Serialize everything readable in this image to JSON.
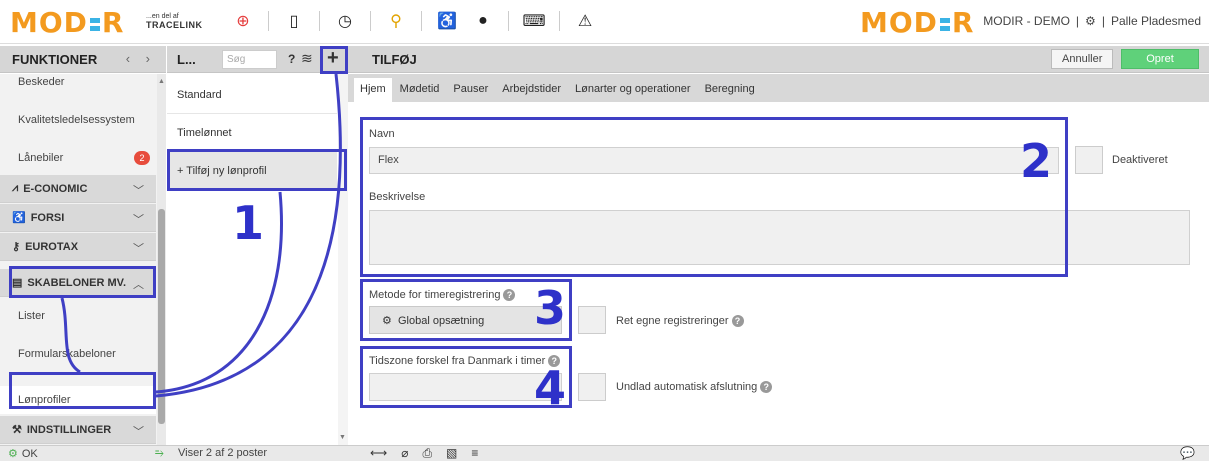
{
  "header": {
    "logo_text": "MODIR",
    "tagline_small": "...en del af",
    "tagline_brand": "TRACELINK",
    "company": "MODIR - DEMO",
    "separator": "|",
    "user": "Palle Pladesmed",
    "icons": [
      "lifebuoy-icon",
      "mobile-icon",
      "clock-alert-icon",
      "network-icon",
      "accessibility-icon",
      "chat-icon",
      "keyboard-icon",
      "warning-icon"
    ]
  },
  "funktioner": {
    "title": "FUNKTIONER",
    "nav": "‹ ›",
    "items_top": [
      {
        "label": "Beskeder"
      },
      {
        "label": "Kvalitetsledelsessystem"
      },
      {
        "label": "Lånebiler",
        "badge": "2"
      }
    ],
    "groups": [
      {
        "label": "E-CONOMIC"
      },
      {
        "label": "FORSI"
      },
      {
        "label": "EUROTAX"
      },
      {
        "label": "SKABELONER MV."
      }
    ],
    "sub_items": [
      {
        "label": "Lister"
      },
      {
        "label": "Formularskabeloner"
      },
      {
        "label": "Lønprofiler"
      }
    ],
    "bottom_group": {
      "label": "INDSTILLINGER"
    }
  },
  "profiles": {
    "title": "L...",
    "search_placeholder": "Søg",
    "help": "?",
    "add": "+",
    "items": [
      "Standard",
      "Timelønnet",
      "+ Tilføj ny lønprofil"
    ]
  },
  "main": {
    "title": "TILFØJ",
    "cancel": "Annuller",
    "create": "Opret",
    "tabs": [
      "Hjem",
      "Mødetid",
      "Pauser",
      "Arbejdstider",
      "Lønarter og operationer",
      "Beregning"
    ],
    "navn_label": "Navn",
    "navn_value": "Flex",
    "deaktiveret": "Deaktiveret",
    "beskrivelse_label": "Beskrivelse",
    "metode_label": "Metode for timeregistrering",
    "global_button": "Global opsætning",
    "ret_egne": "Ret egne registreringer",
    "tidszone_label": "Tidszone forskel fra Danmark i timer",
    "undlad": "Undlad automatisk afslutning"
  },
  "annotations": [
    "1",
    "2",
    "3",
    "4"
  ],
  "status": {
    "ok": "OK",
    "count": "Viser 2 af 2 poster"
  }
}
